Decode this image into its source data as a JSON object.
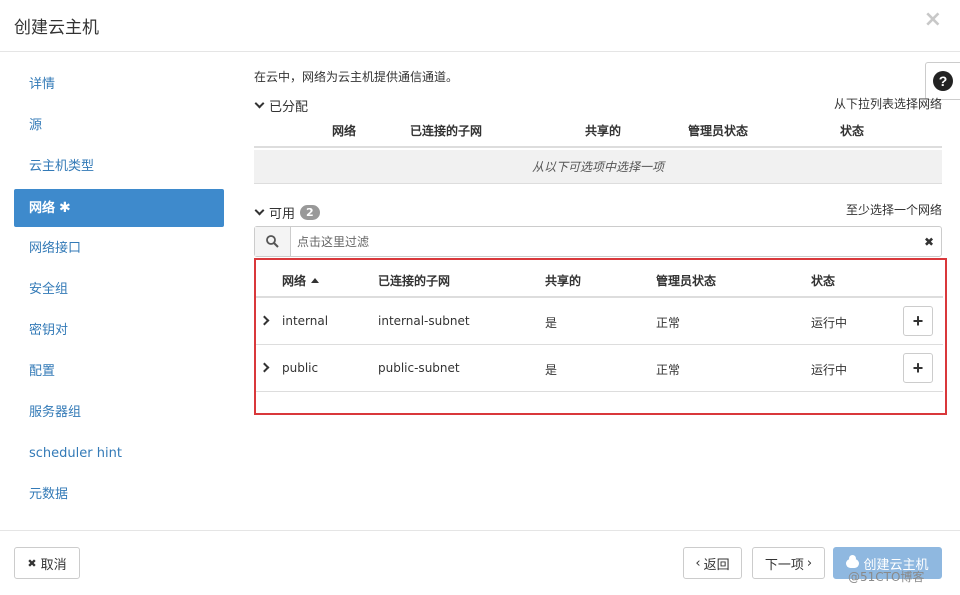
{
  "header": {
    "title": "创建云主机",
    "close": "×"
  },
  "sidebar": {
    "items": [
      {
        "label": "详情"
      },
      {
        "label": "源"
      },
      {
        "label": "云主机类型"
      },
      {
        "label": "网络",
        "star": "✱"
      },
      {
        "label": "网络接口"
      },
      {
        "label": "安全组"
      },
      {
        "label": "密钥对"
      },
      {
        "label": "配置"
      },
      {
        "label": "服务器组"
      },
      {
        "label": "scheduler hint"
      },
      {
        "label": "元数据"
      }
    ]
  },
  "help": {
    "icon": "?"
  },
  "main": {
    "description": "在云中，网络为云主机提供通信通道。",
    "allocated": {
      "label": "已分配",
      "hint": "从下拉列表选择网络",
      "columns": [
        "网络",
        "已连接的子网",
        "共享的",
        "管理员状态",
        "状态"
      ],
      "empty_text": "从以下可选项中选择一项"
    },
    "available": {
      "label": "可用",
      "count": "2",
      "hint": "至少选择一个网络",
      "filter_placeholder": "点击这里过滤",
      "columns": [
        "网络",
        "已连接的子网",
        "共享的",
        "管理员状态",
        "状态"
      ],
      "rows": [
        {
          "network": "internal",
          "subnet": "internal-subnet",
          "shared": "是",
          "admin_state": "正常",
          "status": "运行中"
        },
        {
          "network": "public",
          "subnet": "public-subnet",
          "shared": "是",
          "admin_state": "正常",
          "status": "运行中"
        }
      ],
      "add_label": "+"
    }
  },
  "footer": {
    "cancel": "取消",
    "back": "返回",
    "next": "下一项",
    "create": "创建云主机"
  },
  "watermark": "@51CTO博客"
}
